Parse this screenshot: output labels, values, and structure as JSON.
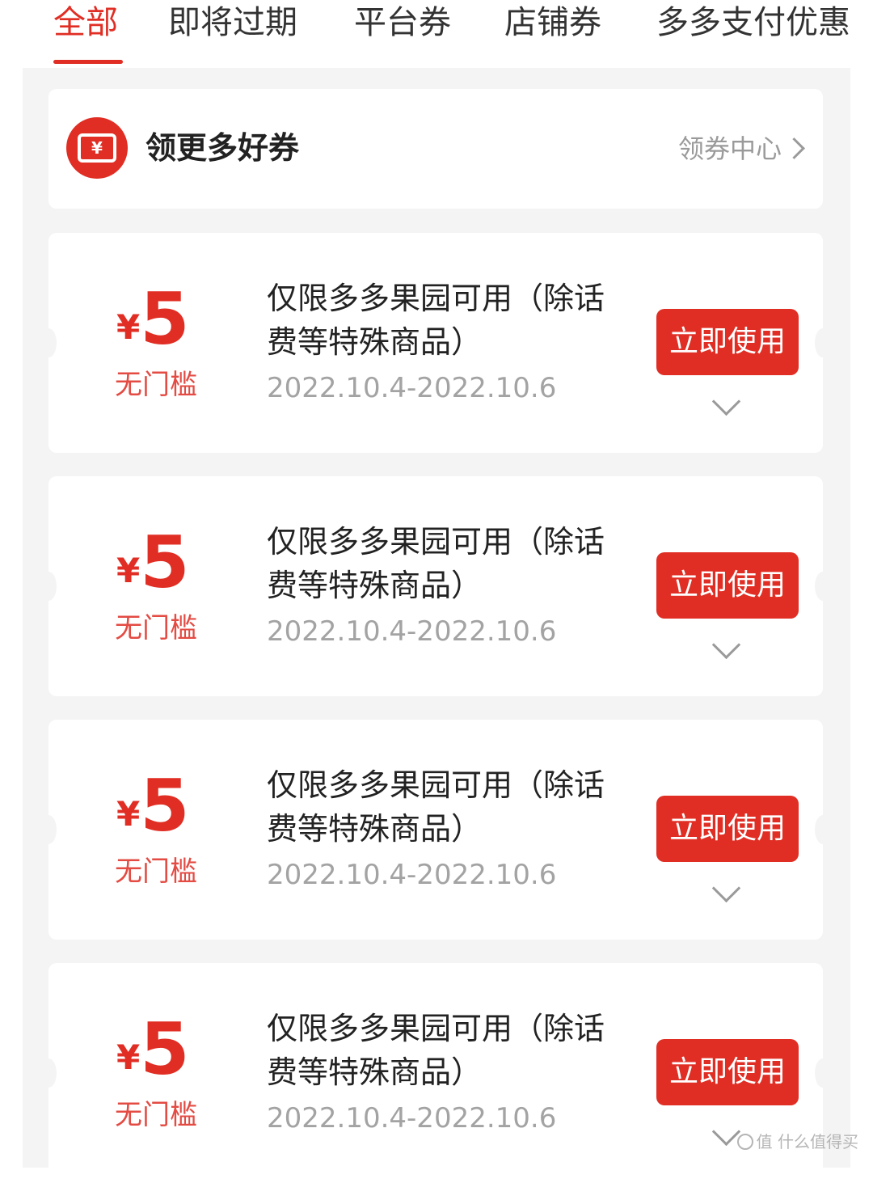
{
  "tabs": [
    {
      "label": "全部",
      "active": true
    },
    {
      "label": "即将过期",
      "active": false
    },
    {
      "label": "平台券",
      "active": false
    },
    {
      "label": "店铺券",
      "active": false
    },
    {
      "label": "多多支付优惠",
      "active": false
    }
  ],
  "banner": {
    "icon": "ticket-icon",
    "icon_glyph": "¥",
    "title": "领更多好券",
    "link_label": "领券中心"
  },
  "coupons": [
    {
      "currency": "¥",
      "amount": "5",
      "threshold": "无门槛",
      "description": "仅限多多果园可用（除话费等特殊商品）",
      "date_range": "2022.10.4-2022.10.6",
      "button": "立即使用"
    },
    {
      "currency": "¥",
      "amount": "5",
      "threshold": "无门槛",
      "description": "仅限多多果园可用（除话费等特殊商品）",
      "date_range": "2022.10.4-2022.10.6",
      "button": "立即使用"
    },
    {
      "currency": "¥",
      "amount": "5",
      "threshold": "无门槛",
      "description": "仅限多多果园可用（除话费等特殊商品）",
      "date_range": "2022.10.4-2022.10.6",
      "button": "立即使用"
    },
    {
      "currency": "¥",
      "amount": "5",
      "threshold": "无门槛",
      "description": "仅限多多果园可用（除话费等特殊商品）",
      "date_range": "2022.10.4-2022.10.6",
      "button": "立即使用"
    }
  ],
  "watermark": {
    "text": "值 什么值得买"
  },
  "colors": {
    "accent": "#e02e24",
    "muted_text": "#a3a3a3",
    "page_bg": "#f4f4f4"
  }
}
